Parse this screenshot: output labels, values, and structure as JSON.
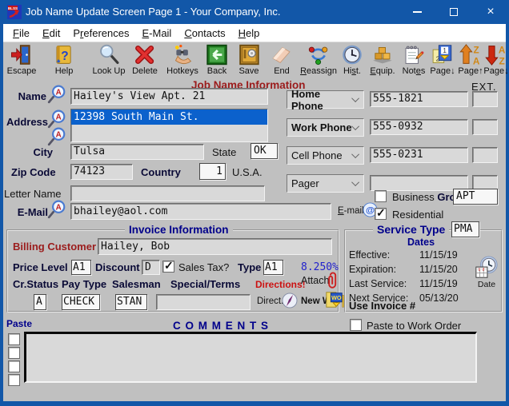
{
  "colors": {
    "titlebar_blue": "#1257a8",
    "window_gray": "#c0c0c0",
    "section_navy": "#00008b",
    "heading_maroon": "#9b1c1c",
    "selection_blue": "#0b61cc",
    "tax_rate_blue": "#2222cc",
    "alert_red": "#cc1111"
  },
  "window": {
    "title": "Job Name Update Screen Page 1 - Your Company, Inc.",
    "app_icon_text": "BLSS"
  },
  "menu": [
    {
      "pre": "",
      "key": "F",
      "post": "ile"
    },
    {
      "pre": "",
      "key": "E",
      "post": "dit"
    },
    {
      "pre": "P",
      "key": "r",
      "post": "eferences"
    },
    {
      "pre": "",
      "key": "E",
      "post": "-Mail"
    },
    {
      "pre": "",
      "key": "C",
      "post": "ontacts"
    },
    {
      "pre": "",
      "key": "H",
      "post": "elp"
    }
  ],
  "toolbar": [
    {
      "icon": "escape-door-icon",
      "pre": "Escape",
      "key": "",
      "post": ""
    },
    {
      "icon": "help-book-icon",
      "pre": "Help",
      "key": "",
      "post": ""
    },
    {
      "icon": "lookup-magnifier-icon",
      "pre": "Look Up",
      "key": "",
      "post": ""
    },
    {
      "icon": "delete-x-icon",
      "pre": "Delete",
      "key": "",
      "post": ""
    },
    {
      "icon": "hotkeys-hand-icon",
      "pre": "Hotkeys",
      "key": "",
      "post": ""
    },
    {
      "icon": "back-arrow-icon",
      "pre": "Back",
      "key": "",
      "post": ""
    },
    {
      "icon": "save-safe-icon",
      "pre": "Save",
      "key": "",
      "post": ""
    },
    {
      "icon": "end-eraser-icon",
      "pre": "End",
      "key": "",
      "post": ""
    },
    {
      "icon": "reassign-cycle-icon",
      "pre": "",
      "key": "R",
      "post": "eassign"
    },
    {
      "icon": "history-clock-icon",
      "pre": "Hi",
      "key": "s",
      "post": "t."
    },
    {
      "icon": "equipment-boxes-icon",
      "pre": "",
      "key": "E",
      "post": "quip."
    },
    {
      "icon": "notes-notepad-icon",
      "pre": "Not",
      "key": "e",
      "post": "s"
    },
    {
      "icon": "page-down-pages-icon",
      "pre": "Page↓",
      "key": "",
      "post": ""
    },
    {
      "icon": "page-up-za-icon",
      "pre": "Page↑",
      "key": "",
      "post": ""
    },
    {
      "icon": "page-down-az-icon",
      "pre": "Page↓",
      "key": "",
      "post": ""
    }
  ],
  "job": {
    "section_title": "Job Name Information",
    "ext_label": "EXT.",
    "name": {
      "label": "Name",
      "value": "Hailey's View Apt. 21"
    },
    "address": {
      "label": "Address",
      "line1": "12398 South Main St.",
      "line2": ""
    },
    "city": {
      "label": "City",
      "value": "Tulsa"
    },
    "state": {
      "label": "State",
      "value": "OK"
    },
    "zip": {
      "label": "Zip Code",
      "value": "74123"
    },
    "country": {
      "label": "Country",
      "value": "1",
      "suffix": "U.S.A."
    },
    "letter_name": {
      "label": "Letter Name",
      "value": ""
    },
    "email": {
      "label": "E-Mail",
      "value": "bhailey@aol.com",
      "emails_key": "E",
      "emails_post": "-mails"
    },
    "phones": [
      {
        "type": "Home Phone",
        "number": "555-1821",
        "ext": ""
      },
      {
        "type": "Work Phone",
        "number": "555-0932",
        "ext": ""
      },
      {
        "type": "Cell Phone",
        "number": "555-0231",
        "ext": ""
      },
      {
        "type": "Pager",
        "number": "",
        "ext": ""
      }
    ],
    "business_group": {
      "business_label": "Business",
      "group_label": "Group",
      "value": "APT",
      "checked": false
    },
    "residential": {
      "label": "Residential",
      "checked": true
    }
  },
  "invoice": {
    "section_title": "Invoice Information",
    "billing": {
      "label": "Billing Customer",
      "value": "Hailey, Bob"
    },
    "price_level": {
      "label": "Price Level",
      "value": "A1"
    },
    "discount": {
      "label": "Discount",
      "value": "D"
    },
    "sales_tax": {
      "label": "Sales Tax?",
      "checked": true
    },
    "type": {
      "label": "Type",
      "value": "A1"
    },
    "tax_rate": "8.250%",
    "cr_status": {
      "label": "Cr.Status",
      "value": "A"
    },
    "pay_type": {
      "label": "Pay Type",
      "value": "CHECK"
    },
    "salesman": {
      "label": "Salesman",
      "value": "STAN"
    },
    "special_terms": {
      "label": "Special/Terms",
      "value": ""
    },
    "directions_label": "Directions!",
    "attach_label": "Attach",
    "direct_label": "Direct.",
    "new_wo_label": "New WO"
  },
  "service": {
    "section_title": "Service Type",
    "type_value": "PMA",
    "dates_label": "Dates",
    "rows": [
      {
        "label": "Effective:",
        "value": "11/15/19"
      },
      {
        "label": "Expiration:",
        "value": "11/15/20"
      },
      {
        "label": "Last Service:",
        "value": "11/15/19"
      },
      {
        "label": "Next Service:",
        "value": "05/13/20"
      }
    ],
    "use_invoice_label": "Use Invoice #",
    "date_icon_label": "Date"
  },
  "comments": {
    "paste_label": "Paste",
    "title": "C O M M E N T S",
    "paste_to_wo": {
      "label": "Paste to Work Order",
      "checked": false
    },
    "paste_checks": [
      false,
      false,
      false,
      false
    ],
    "text": ""
  }
}
